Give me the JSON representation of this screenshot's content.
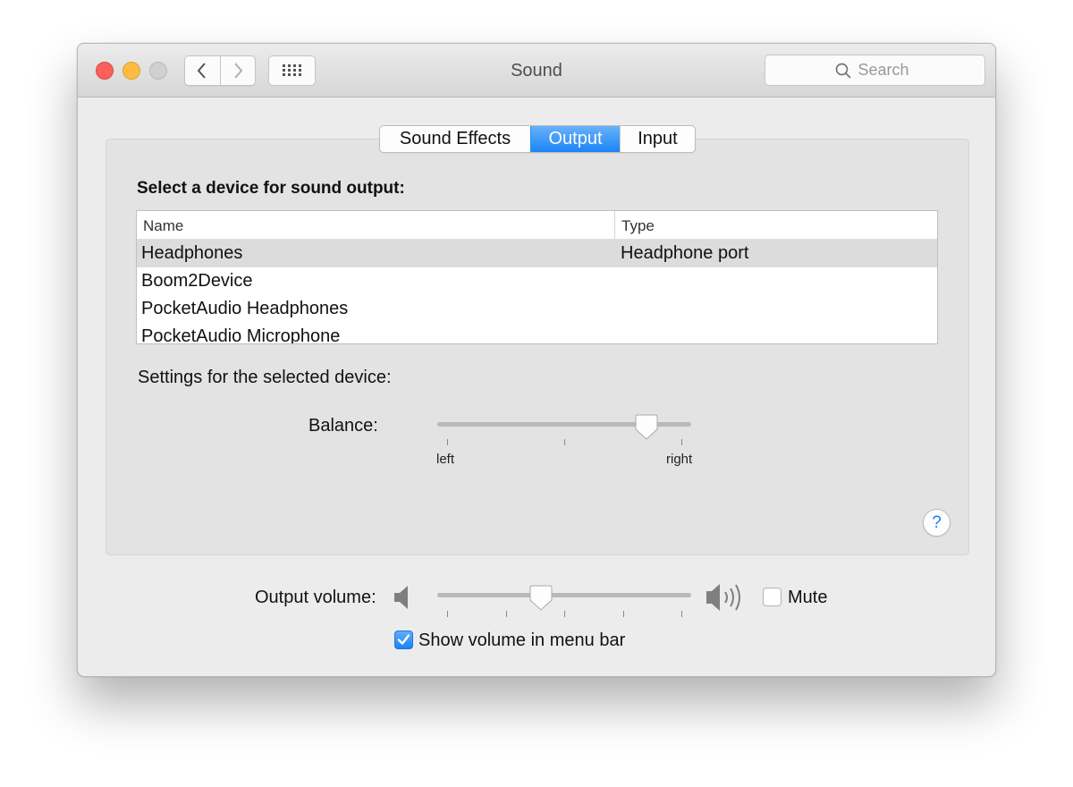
{
  "window": {
    "title": "Sound"
  },
  "search": {
    "placeholder": "Search"
  },
  "tabs": [
    {
      "label": "Sound Effects",
      "active": false
    },
    {
      "label": "Output",
      "active": true
    },
    {
      "label": "Input",
      "active": false
    }
  ],
  "output": {
    "heading": "Select a device for sound output:",
    "columns": {
      "name": "Name",
      "type": "Type"
    },
    "devices": [
      {
        "name": "Headphones",
        "type": "Headphone port",
        "selected": true
      },
      {
        "name": "Boom2Device",
        "type": ""
      },
      {
        "name": "PocketAudio Headphones",
        "type": ""
      },
      {
        "name": "PocketAudio Microphone",
        "type": ""
      }
    ],
    "settings_label": "Settings for the selected device:",
    "balance": {
      "label": "Balance:",
      "left_label": "left",
      "right_label": "right",
      "value": 0.85
    }
  },
  "help": {
    "label": "?"
  },
  "volume": {
    "label": "Output volume:",
    "value": 0.4,
    "mute_label": "Mute",
    "mute_checked": false,
    "show_in_menu_label": "Show volume in menu bar",
    "show_in_menu_checked": true
  },
  "icons": {
    "back": "chevron-left-icon",
    "forward": "chevron-right-icon",
    "grid": "grid-icon",
    "search": "search-icon",
    "speaker_low": "speaker-low-icon",
    "speaker_high": "speaker-high-icon",
    "help": "help-icon",
    "check": "checkmark-icon"
  },
  "colors": {
    "accent": "#1b84f5",
    "close": "#fc605c",
    "minimize": "#fdbc40",
    "zoom_disabled": "#d0d0d0"
  }
}
